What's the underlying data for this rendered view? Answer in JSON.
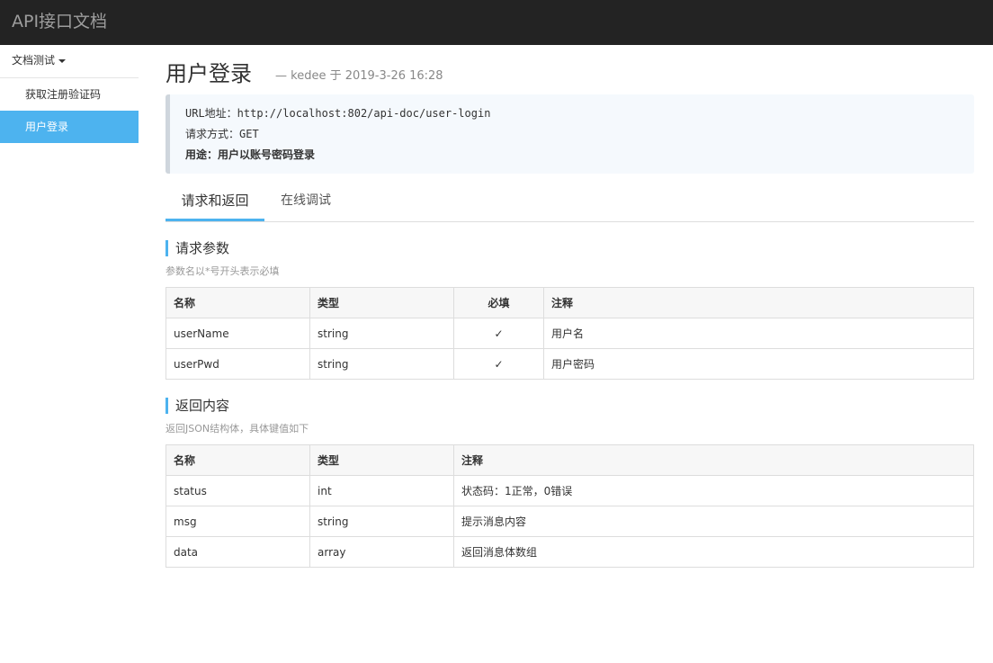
{
  "header": {
    "brand": "API接口文档"
  },
  "sidebar": {
    "group": "文档测试",
    "items": [
      {
        "label": "获取注册验证码",
        "active": false
      },
      {
        "label": "用户登录",
        "active": true
      }
    ]
  },
  "page": {
    "title": "用户登录",
    "meta": "— kedee  于 2019-3-26 16:28"
  },
  "info": {
    "url_line": "URL地址：http://localhost:802/api-doc/user-login",
    "method_line": "请求方式：GET",
    "purpose_line": "用途：用户以账号密码登录"
  },
  "tabs": [
    {
      "label": "请求和返回",
      "active": true
    },
    {
      "label": "在线调试",
      "active": false
    }
  ],
  "request": {
    "title": "请求参数",
    "subtitle": "参数名以*号开头表示必填",
    "columns": [
      "名称",
      "类型",
      "必填",
      "注释"
    ],
    "rows": [
      {
        "name": "userName",
        "type": "string",
        "required": "✓",
        "note": "用户名"
      },
      {
        "name": "userPwd",
        "type": "string",
        "required": "✓",
        "note": "用户密码"
      }
    ]
  },
  "response": {
    "title": "返回内容",
    "subtitle": "返回JSON结构体，具体键值如下",
    "columns": [
      "名称",
      "类型",
      "注释"
    ],
    "rows": [
      {
        "name": "status",
        "type": "int",
        "note": "状态码：1正常，0错误"
      },
      {
        "name": "msg",
        "type": "string",
        "note": "提示消息内容"
      },
      {
        "name": "data",
        "type": "array",
        "note": "返回消息体数组"
      }
    ]
  },
  "colors": {
    "accent": "#4db3ef",
    "topbar": "#232323"
  }
}
